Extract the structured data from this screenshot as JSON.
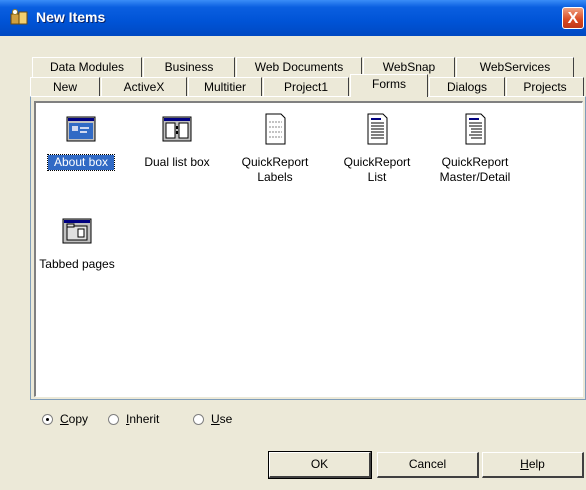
{
  "window": {
    "title": "New Items",
    "close_glyph": "X"
  },
  "tabs_row1": [
    {
      "label": "Data Modules"
    },
    {
      "label": "Business"
    },
    {
      "label": "Web Documents"
    },
    {
      "label": "WebSnap"
    },
    {
      "label": "WebServices"
    }
  ],
  "tabs_row2": [
    {
      "label": "New"
    },
    {
      "label": "ActiveX"
    },
    {
      "label": "Multitier"
    },
    {
      "label": "Project1"
    },
    {
      "label": "Forms",
      "active": true
    },
    {
      "label": "Dialogs"
    },
    {
      "label": "Projects"
    }
  ],
  "items": [
    {
      "label": "About box",
      "icon": "about-box-icon",
      "selected": true
    },
    {
      "label": "Dual list box",
      "icon": "dual-list-box-icon"
    },
    {
      "label": "QuickReport\nLabels",
      "icon": "quickreport-labels-icon"
    },
    {
      "label": "QuickReport\nList",
      "icon": "quickreport-list-icon"
    },
    {
      "label": "QuickReport\nMaster/Detail",
      "icon": "quickreport-master-detail-icon"
    },
    {
      "label": "Tabbed pages",
      "icon": "tabbed-pages-icon"
    }
  ],
  "options": {
    "copy": {
      "label": "Copy",
      "mnemonic": "C",
      "rest": "opy",
      "checked": true
    },
    "inherit": {
      "label": "Inherit",
      "mnemonic": "I",
      "rest": "nherit",
      "checked": false
    },
    "use": {
      "label": "Use",
      "mnemonic": "U",
      "rest": "se",
      "checked": false
    }
  },
  "buttons": {
    "ok": "OK",
    "cancel": "Cancel",
    "help_mnemonic": "H",
    "help_rest": "elp"
  }
}
